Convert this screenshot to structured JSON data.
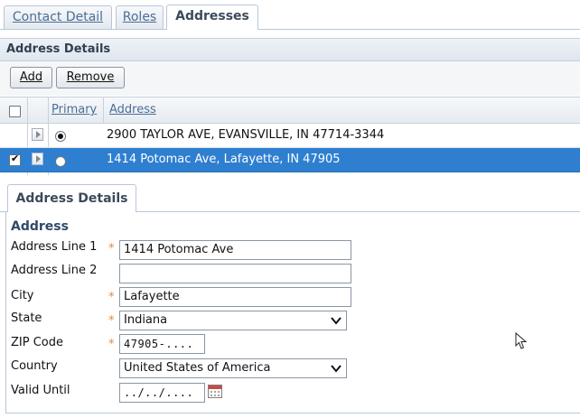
{
  "tabs": [
    {
      "label": "Contact Detail",
      "active": false
    },
    {
      "label": "Roles",
      "active": false
    },
    {
      "label": "Addresses",
      "active": true
    }
  ],
  "panel": {
    "title": "Address Details"
  },
  "toolbar": {
    "add_label": "Add",
    "remove_label": "Remove"
  },
  "grid": {
    "columns": {
      "primary": "Primary",
      "address": "Address"
    },
    "rows": [
      {
        "address": "2900 TAYLOR AVE, EVANSVILLE, IN 47714-3344",
        "primary": true,
        "checked": false,
        "selected": false
      },
      {
        "address": "1414 Potomac Ave, Lafayette, IN 47905",
        "primary": false,
        "checked": true,
        "selected": true
      }
    ]
  },
  "detail": {
    "tab_label": "Address Details",
    "section_title": "Address",
    "fields": {
      "address_line1": {
        "label": "Address Line 1",
        "value": "1414 Potomac Ave",
        "required": true
      },
      "address_line2": {
        "label": "Address Line 2",
        "value": "",
        "required": false
      },
      "city": {
        "label": "City",
        "value": "Lafayette",
        "required": true
      },
      "state": {
        "label": "State",
        "value": "Indiana",
        "required": true
      },
      "zip": {
        "label": "ZIP Code",
        "value": "47905-....",
        "required": true
      },
      "country": {
        "label": "Country",
        "value": "United States of America",
        "required": false
      },
      "valid_until": {
        "label": "Valid Until",
        "value": "../../....",
        "required": false
      }
    },
    "required_marker": "*"
  },
  "colors": {
    "selection": "#2e7fd0",
    "link": "#4a6e96",
    "required": "#e08a3c"
  },
  "icons": {
    "calendar": "calendar-icon",
    "cursor": "mouse-pointer-icon",
    "expander": "row-expand-icon"
  }
}
